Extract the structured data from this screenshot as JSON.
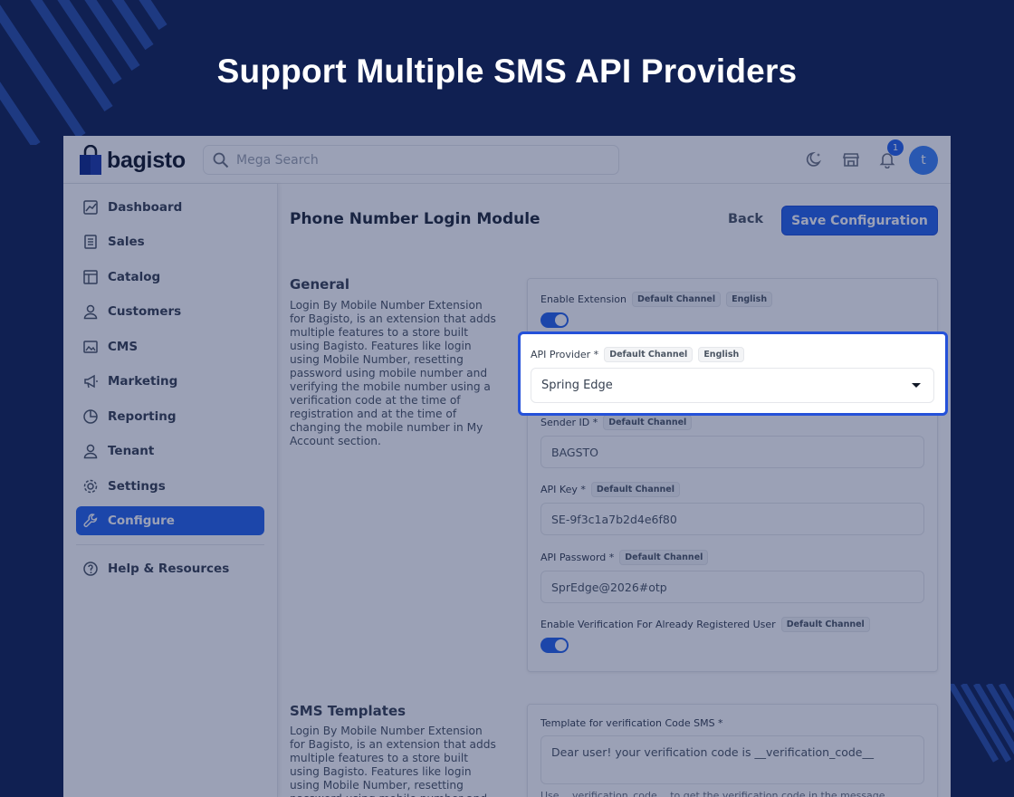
{
  "headline": "Support Multiple SMS API Providers",
  "app": {
    "logo_text": "bagisto",
    "search_placeholder": "Mega Search",
    "notification_count": "1",
    "avatar_initial": "t"
  },
  "sidebar": {
    "items": [
      {
        "label": "Dashboard",
        "icon": "dashboard-icon"
      },
      {
        "label": "Sales",
        "icon": "sales-icon"
      },
      {
        "label": "Catalog",
        "icon": "catalog-icon"
      },
      {
        "label": "Customers",
        "icon": "customers-icon"
      },
      {
        "label": "CMS",
        "icon": "cms-icon"
      },
      {
        "label": "Marketing",
        "icon": "megaphone-icon"
      },
      {
        "label": "Reporting",
        "icon": "pie-chart-icon"
      },
      {
        "label": "Tenant",
        "icon": "tenant-icon"
      },
      {
        "label": "Settings",
        "icon": "gear-icon"
      },
      {
        "label": "Configure",
        "icon": "wrench-icon",
        "active": true
      }
    ],
    "help_label": "Help & Resources"
  },
  "page": {
    "title": "Phone Number Login Module",
    "back_label": "Back",
    "save_label": "Save Configuration"
  },
  "general": {
    "title": "General",
    "description": "Login By Mobile Number Extension for Bagisto, is an extension that adds multiple features to a store built using Bagisto. Features like login using Mobile Number, resetting password using mobile number and verifying the mobile number using a verification code at the time of registration and at the time of changing the mobile number in My Account section.",
    "enable_extension_label": "Enable Extension",
    "enable_extension_value": true,
    "api_provider_label": "API Provider *",
    "api_provider_value": "Spring Edge",
    "sender_id_label": "Sender ID *",
    "sender_id_value": "BAGSTO",
    "api_key_label": "API Key *",
    "api_key_value": "SE-9f3c1a7b2d4e6f80",
    "api_password_label": "API Password *",
    "api_password_value": "SprEdge@2026#otp",
    "verify_registered_label": "Enable Verification For Already Registered User",
    "verify_registered_value": true
  },
  "chips": {
    "default_channel": "Default Channel",
    "english": "English"
  },
  "sms_templates": {
    "title": "SMS Templates",
    "description": "Login By Mobile Number Extension for Bagisto, is an extension that adds multiple features to a store built using Bagisto. Features like login using Mobile Number, resetting password using mobile number and",
    "template_label": "Template for verification Code SMS *",
    "template_value": "Dear user! your verification code is __verification_code__",
    "hint": "Use __verification_code__ to get the verification code in the message"
  },
  "colors": {
    "background": "#102052",
    "accent": "#2563eb",
    "highlight_border": "#2451d9"
  }
}
